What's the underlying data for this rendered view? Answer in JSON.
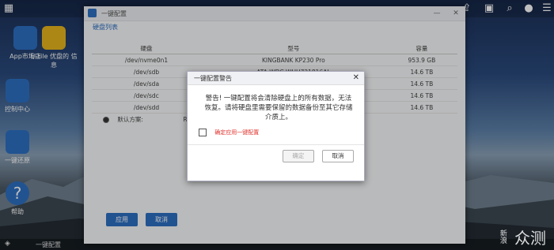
{
  "desktop": {
    "icons": [
      {
        "label": "App市场店",
        "icon": "app-store-icon",
        "color": "#2d6fc2"
      },
      {
        "label": "U-File 优盘的 信息",
        "icon": "file-manager-icon",
        "color": "#e6b41c"
      },
      {
        "label": "控制中心",
        "icon": "control-center-icon",
        "color": "#2d6fc2"
      },
      {
        "label": "一键还原",
        "icon": "backup-icon",
        "color": "#2d6fc2"
      },
      {
        "label": "帮助",
        "icon": "help-icon",
        "color": "#2d6fc2"
      }
    ],
    "taskbar_label": "一键配置"
  },
  "window": {
    "title": "一键配置",
    "subtitle": "硬盘列表",
    "columns": [
      "硬盘",
      "型号",
      "容量"
    ],
    "rows": [
      [
        "/dev/nvme0n1",
        "KINGBANK KP230 Pro",
        "953.9 GB"
      ],
      [
        "/dev/sdb",
        "ATA WDC WUH721816AL",
        "14.6 TB"
      ],
      [
        "/dev/sda",
        "",
        "14.6 TB"
      ],
      [
        "/dev/sdc",
        "",
        "14.6 TB"
      ],
      [
        "/dev/sdd",
        "",
        "14.6 TB"
      ]
    ],
    "radio_label": "默认方案:",
    "radio_value": "RAID5",
    "apply_label": "应用",
    "cancel_label": "取消"
  },
  "dialog": {
    "title": "一键配置警告",
    "warning": "警告! 一键配置将会清除硬盘上的所有数据，无法恢复。请将硬盘里需要保留的数据备份至其它存储介质上。",
    "checkbox_label": "确定应用一键配置",
    "confirm_label": "确定",
    "cancel_label": "取消"
  },
  "watermark": {
    "line1": "新",
    "line2": "浪",
    "text": "众测"
  }
}
